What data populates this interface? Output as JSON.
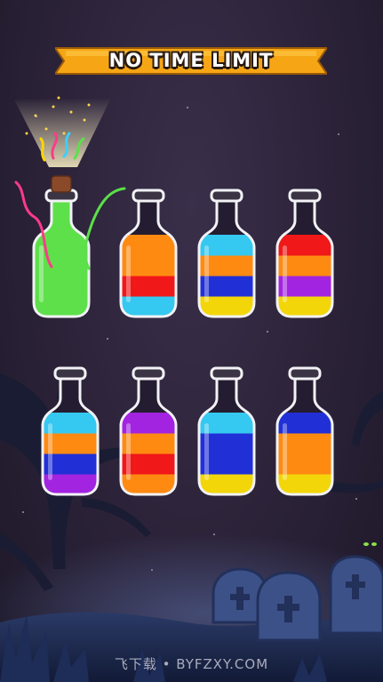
{
  "header": {
    "banner_text": "NO TIME LIMIT"
  },
  "watermark": "飞下载 • BYFZXY.COM",
  "colors": {
    "green": "#5ee04a",
    "orange": "#ff8a12",
    "red": "#f01818",
    "blue": "#2130d6",
    "cyan": "#35c8f0",
    "yellow": "#f3d60a",
    "purple": "#a224e0",
    "pink": "#e33aa6"
  },
  "bottles": [
    {
      "id": "bottle-1",
      "state": "completed-corked",
      "layers": [
        "green",
        "green",
        "green",
        "green"
      ]
    },
    {
      "id": "bottle-2",
      "layers": [
        "cyan",
        "red",
        "orange",
        "orange"
      ]
    },
    {
      "id": "bottle-3",
      "layers": [
        "yellow",
        "blue",
        "orange",
        "cyan"
      ]
    },
    {
      "id": "bottle-4",
      "layers": [
        "yellow",
        "purple",
        "orange",
        "red"
      ]
    },
    {
      "id": "bottle-5",
      "layers": [
        "purple",
        "blue",
        "orange",
        "cyan"
      ]
    },
    {
      "id": "bottle-6",
      "layers": [
        "orange",
        "red",
        "orange",
        "purple"
      ]
    },
    {
      "id": "bottle-7",
      "layers": [
        "yellow",
        "blue",
        "blue",
        "cyan"
      ]
    },
    {
      "id": "bottle-8",
      "layers": [
        "yellow",
        "orange",
        "orange",
        "blue"
      ]
    }
  ]
}
